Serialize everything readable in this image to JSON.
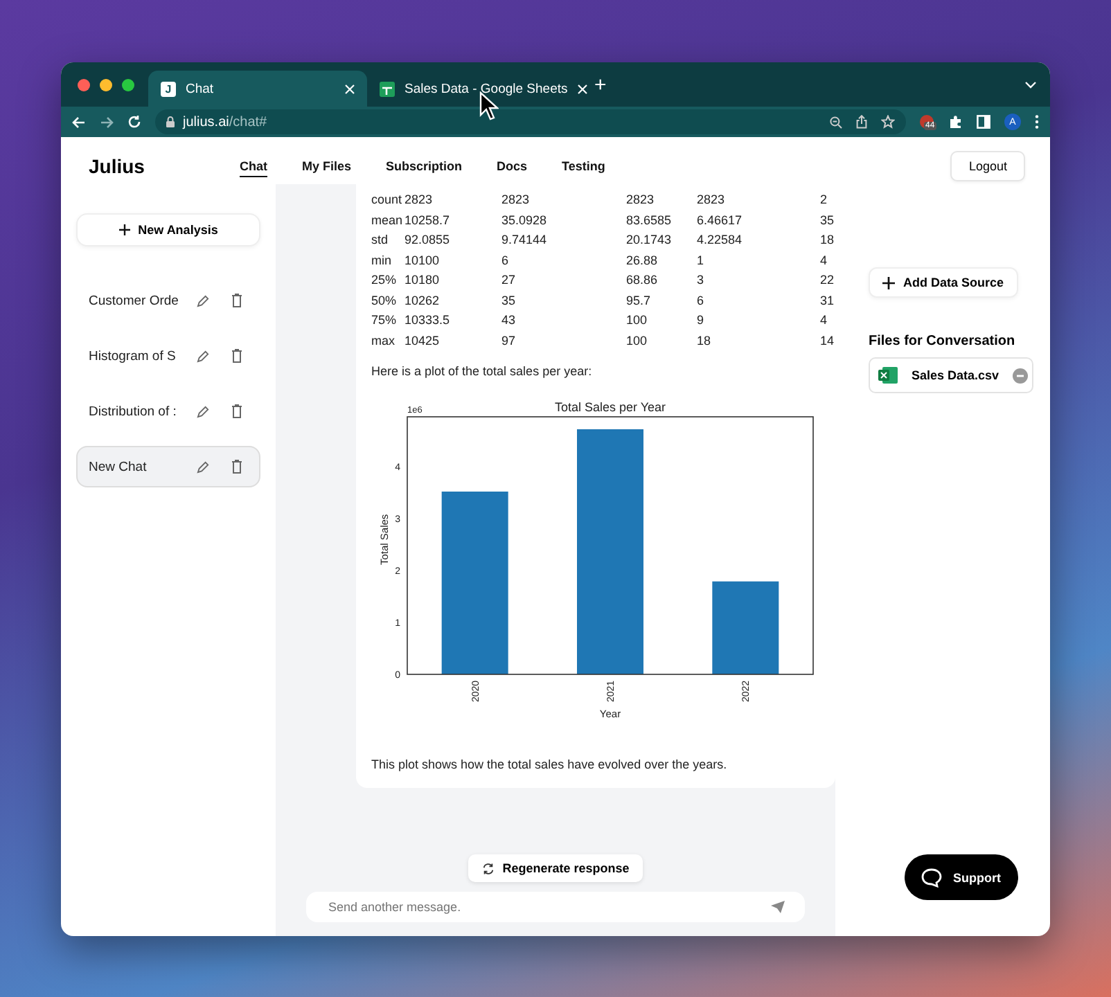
{
  "browser": {
    "tabs": [
      {
        "title": "Chat",
        "icon": "J",
        "kind": "letter",
        "selected": true
      },
      {
        "title": "Sales Data - Google Sheets",
        "kind": "sheets",
        "selected": false
      }
    ],
    "new_tab": "+",
    "url": {
      "domain": "julius.ai",
      "path": "/chat#"
    },
    "extension_badge": "44",
    "profile": "A"
  },
  "header": {
    "logo": "Julius",
    "nav": [
      {
        "label": "Chat",
        "selected": true
      },
      {
        "label": "My Files",
        "selected": false
      },
      {
        "label": "Subscription",
        "selected": false
      },
      {
        "label": "Docs",
        "selected": false
      },
      {
        "label": "Testing",
        "selected": false
      }
    ],
    "logout": "Logout"
  },
  "sidebar": {
    "new_analysis": "New Analysis",
    "chats": [
      {
        "title": "Customer Orde",
        "selected": false
      },
      {
        "title": "Histogram of S",
        "selected": false
      },
      {
        "title": "Distribution of :",
        "selected": false
      },
      {
        "title": "New Chat",
        "selected": true
      }
    ]
  },
  "conversation": {
    "stats": [
      {
        "label": "count",
        "values": [
          "2823",
          "2823",
          "2823",
          "2823",
          "2"
        ]
      },
      {
        "label": "mean",
        "values": [
          "10258.7",
          "35.0928",
          "83.6585",
          "6.46617",
          "35"
        ]
      },
      {
        "label": "std",
        "values": [
          "92.0855",
          "9.74144",
          "20.1743",
          "4.22584",
          "18"
        ]
      },
      {
        "label": "min",
        "values": [
          "10100",
          "6",
          "26.88",
          "1",
          "4"
        ]
      },
      {
        "label": "25%",
        "values": [
          "10180",
          "27",
          "68.86",
          "3",
          "22"
        ]
      },
      {
        "label": "50%",
        "values": [
          "10262",
          "35",
          "95.7",
          "6",
          "31"
        ]
      },
      {
        "label": "75%",
        "values": [
          "10333.5",
          "43",
          "100",
          "9",
          "4"
        ]
      },
      {
        "label": "max",
        "values": [
          "10425",
          "97",
          "100",
          "18",
          "14"
        ]
      }
    ],
    "intro": "Here is a plot of the total sales per year:",
    "chart_data": {
      "type": "bar",
      "title": "Total Sales per Year",
      "xlabel": "Year",
      "ylabel": "Total Sales",
      "categories": [
        "2020",
        "2021",
        "2022"
      ],
      "series": [
        {
          "color": "#1f77b4",
          "values": [
            3.52,
            4.72,
            1.79
          ]
        }
      ],
      "ylim": [
        0,
        4.96
      ],
      "yticks": [
        0,
        1,
        2,
        3,
        4
      ],
      "annotations": [
        "1e6"
      ]
    },
    "caption": "This plot shows how the total sales have evolved over the years.",
    "regenerate": "Regenerate response",
    "message_placeholder": "Send another message."
  },
  "data_panel": {
    "add_source": "Add Data Source",
    "files_heading": "Files for Conversation",
    "files": [
      {
        "name": "Sales Data.csv"
      }
    ]
  },
  "support": "Support"
}
